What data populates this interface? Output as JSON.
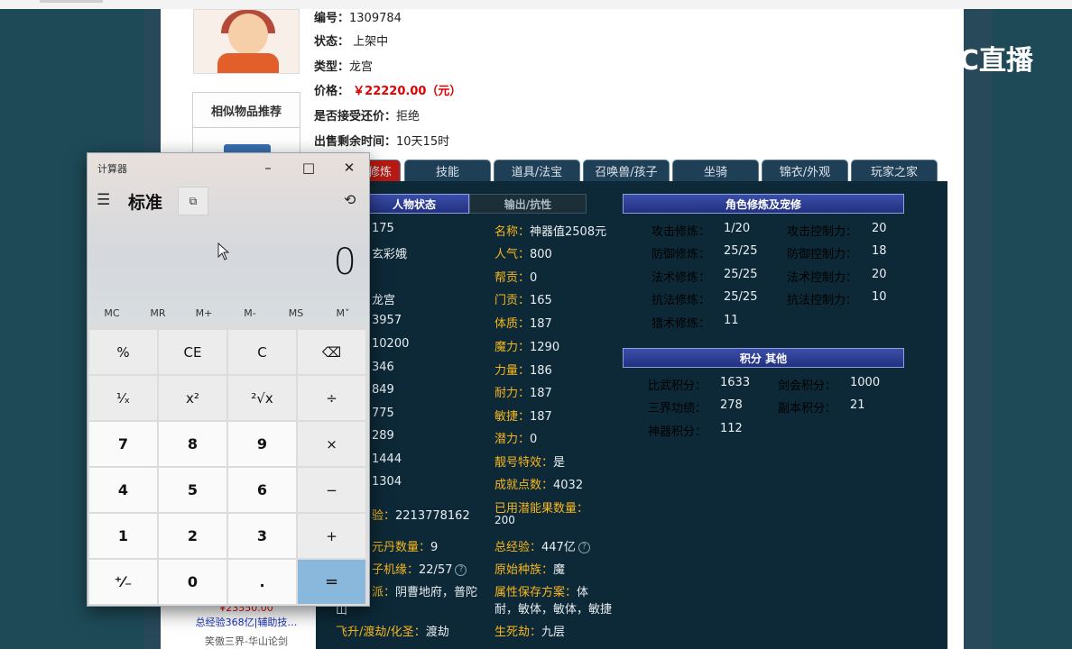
{
  "item": {
    "id_line": {
      "label": "编号：",
      "value": "1309784"
    },
    "status": {
      "label": "状态：",
      "value": "上架中"
    },
    "type": {
      "label": "类型：",
      "value": "龙宫"
    },
    "price": {
      "label": "价格：",
      "value": "￥22220.00（元）"
    },
    "bargain": {
      "label": "是否接受还价：",
      "value": "拒绝"
    },
    "remaining": {
      "label": "出售剩余时间：",
      "value": "10天15时"
    }
  },
  "recommend": {
    "title": "相似物品推荐",
    "price": "¥23550.00",
    "line1": "总经验368亿|辅助技…",
    "line2": "笑傲三界-华山论剑"
  },
  "tabs": [
    "修炼",
    "技能",
    "道具/法宝",
    "召唤兽/孩子",
    "坐骑",
    "锦衣/外观",
    "玩家之家"
  ],
  "panel": {
    "header_status": "人物状态",
    "header_output": "输出/抗性",
    "header_cultivation": "角色修炼及宠修",
    "header_points": "积分 其他",
    "col1_values": [
      "175",
      "玄彩娥",
      "",
      "龙宫",
      "3957",
      "10200",
      "346",
      "849",
      "775",
      "289",
      "1444",
      "1304"
    ],
    "exp_row": {
      "label": "验：",
      "value": "2213778162"
    },
    "pill_row": {
      "label": "元丹数量：",
      "value": "9"
    },
    "child_row": {
      "label": "子机缘：",
      "value": "22/57"
    },
    "faction_row": {
      "label": "派：",
      "value": "阴曹地府，普陀"
    },
    "faction_cont": "山",
    "ascend_row": {
      "label": "飞升/渡劫/化圣：",
      "value": "渡劫"
    },
    "col2": [
      {
        "k": "名称：",
        "v": "神器值2508元"
      },
      {
        "k": "人气：",
        "v": "800"
      },
      {
        "k": "帮贡：",
        "v": "0"
      },
      {
        "k": "门贡：",
        "v": "165"
      },
      {
        "k": "体质：",
        "v": "187"
      },
      {
        "k": "魔力：",
        "v": "1290"
      },
      {
        "k": "力量：",
        "v": "186"
      },
      {
        "k": "耐力：",
        "v": "187"
      },
      {
        "k": "敏捷：",
        "v": "187"
      },
      {
        "k": "潜力：",
        "v": "0"
      },
      {
        "k": "靓号特效：",
        "v": "是"
      },
      {
        "k": "成就点数：",
        "v": "4032"
      }
    ],
    "potion_used": {
      "label": "已用潜能果数量：",
      "value": "200"
    },
    "total_exp": {
      "label": "总经验：",
      "value": "447亿"
    },
    "origin": {
      "label": "原始种族：",
      "value": "魔"
    },
    "attr_plan": {
      "label": "属性保存方案：",
      "value_a": "体",
      "value_b": "耐，敏体，敏体，敏捷"
    },
    "life_death": {
      "label": "生死劫：",
      "value": "九层"
    },
    "cultivation": [
      {
        "k": "攻击修炼：",
        "v": "1/20",
        "k2": "攻击控制力：",
        "v2": "20"
      },
      {
        "k": "防御修炼：",
        "v": "25/25",
        "k2": "防御控制力：",
        "v2": "18"
      },
      {
        "k": "法术修炼：",
        "v": "25/25",
        "k2": "法术控制力：",
        "v2": "20"
      },
      {
        "k": "抗法修炼：",
        "v": "25/25",
        "k2": "抗法控制力：",
        "v2": "10"
      },
      {
        "k": "猎术修炼：",
        "v": "11",
        "k2": "",
        "v2": ""
      }
    ],
    "points": [
      {
        "k": "比武积分：",
        "v": "1633",
        "k2": "剑会积分：",
        "v2": "1000"
      },
      {
        "k": "三界功绩：",
        "v": "278",
        "k2": "副本积分：",
        "v2": "21"
      },
      {
        "k": "神器积分：",
        "v": "112",
        "k2": "",
        "v2": ""
      }
    ]
  },
  "calculator": {
    "title": "计算器",
    "mode": "标准",
    "display": "0",
    "memory": [
      "MC",
      "MR",
      "M+",
      "M-",
      "MS",
      "M˅"
    ],
    "keys": [
      [
        "%",
        "CE",
        "C",
        "⌫"
      ],
      [
        "¹⁄ₓ",
        "x²",
        "²√x",
        "÷"
      ],
      [
        "7",
        "8",
        "9",
        "×"
      ],
      [
        "4",
        "5",
        "6",
        "−"
      ],
      [
        "1",
        "2",
        "3",
        "+"
      ],
      [
        "⁺⁄₋",
        "0",
        ".",
        "="
      ]
    ]
  },
  "overlay_logo": "CC直播",
  "colors": {
    "accent_red": "#b61a12",
    "panel_bg": "#0d2937",
    "label_gold": "#f6b61f",
    "header_blue": "#3a4ea8"
  }
}
